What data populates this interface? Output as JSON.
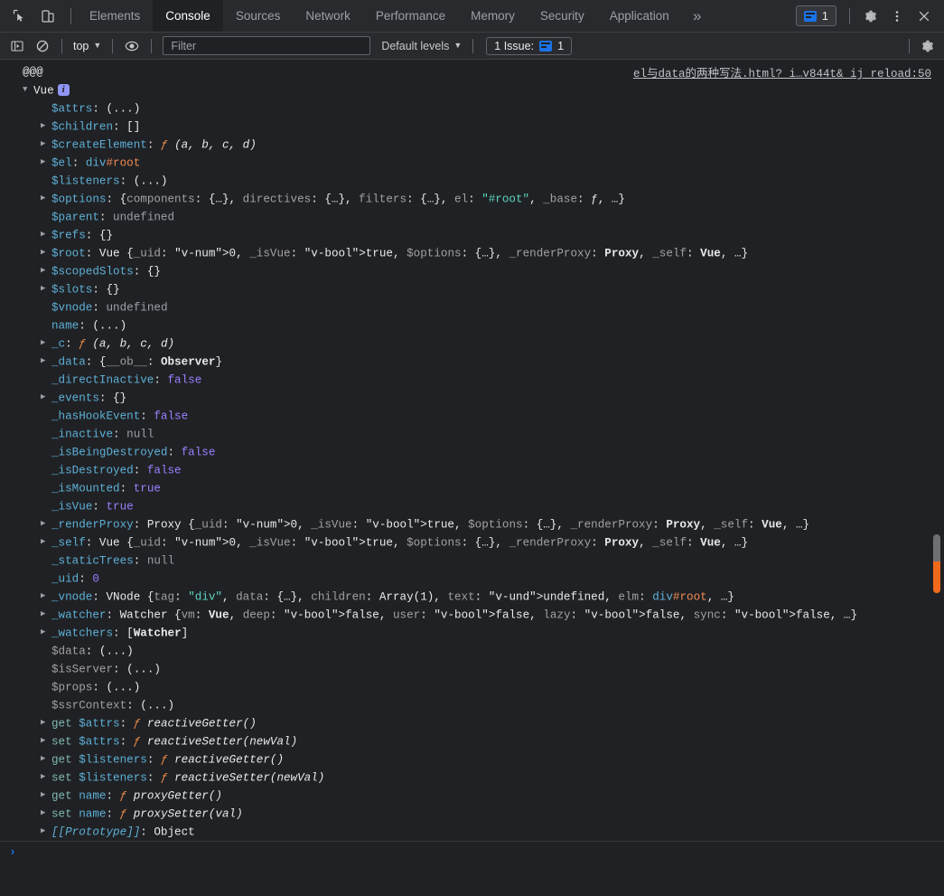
{
  "header": {
    "icons": [
      {
        "name": "inspect-element-icon",
        "title": "Inspect"
      },
      {
        "name": "device-toolbar-icon",
        "title": "Toggle device toolbar"
      }
    ],
    "tabs": [
      {
        "label": "Elements",
        "active": false
      },
      {
        "label": "Console",
        "active": true
      },
      {
        "label": "Sources",
        "active": false
      },
      {
        "label": "Network",
        "active": false
      },
      {
        "label": "Performance",
        "active": false
      },
      {
        "label": "Memory",
        "active": false
      },
      {
        "label": "Security",
        "active": false
      },
      {
        "label": "Application",
        "active": false
      }
    ],
    "more_tabs_label": "»",
    "issues_count": "1",
    "settings_label": "Settings",
    "more_label": "More options",
    "close_label": "Close"
  },
  "toolbar": {
    "sidebar_toggle_name": "console-sidebar-icon",
    "clear_label": "Clear console",
    "context": "top",
    "eye_label": "Create live expression",
    "filter_placeholder": "Filter",
    "filter_value": "",
    "levels": "Default levels",
    "issues_text": "1 Issue:",
    "issues_count": "1",
    "settings_label": "Console settings"
  },
  "console": {
    "source_link": "el与data的两种写法.html?_i…v844t&_ij_reload:50",
    "first_line": "@@@",
    "object_title": "Vue",
    "prompt_symbol": "›",
    "rows": [
      {
        "tri": false,
        "key": "$attrs",
        "keycls": "k-prop",
        "val": "(...)",
        "valcls": "v-obj"
      },
      {
        "tri": true,
        "key": "$children",
        "keycls": "k-prop",
        "val": "[]",
        "valcls": "v-obj"
      },
      {
        "tri": true,
        "key": "$createElement",
        "keycls": "k-prop",
        "val": "ƒ (a, b, c, d)",
        "valcls": "v-fn"
      },
      {
        "tri": true,
        "key": "$el",
        "keycls": "k-prop",
        "val": "div#root",
        "valcls": "v-node-html"
      },
      {
        "tri": false,
        "key": "$listeners",
        "keycls": "k-prop",
        "val": "(...)",
        "valcls": "v-obj"
      },
      {
        "tri": true,
        "key": "$options",
        "keycls": "k-prop",
        "val": "{components: {…}, directives: {…}, filters: {…}, el: \"#root\", _base: ƒ, …}",
        "valcls": "v-preview-options"
      },
      {
        "tri": false,
        "key": "$parent",
        "keycls": "k-prop",
        "val": "undefined",
        "valcls": "v-und"
      },
      {
        "tri": true,
        "key": "$refs",
        "keycls": "k-prop",
        "val": "{}",
        "valcls": "v-obj"
      },
      {
        "tri": true,
        "key": "$root",
        "keycls": "k-prop",
        "val": "Vue {_uid: 0, _isVue: true, $options: {…}, _renderProxy: Proxy, _self: Vue, …}",
        "valcls": "v-preview-vue"
      },
      {
        "tri": true,
        "key": "$scopedSlots",
        "keycls": "k-prop",
        "val": "{}",
        "valcls": "v-obj"
      },
      {
        "tri": true,
        "key": "$slots",
        "keycls": "k-prop",
        "val": "{}",
        "valcls": "v-obj"
      },
      {
        "tri": false,
        "key": "$vnode",
        "keycls": "k-prop",
        "val": "undefined",
        "valcls": "v-und"
      },
      {
        "tri": false,
        "key": "name",
        "keycls": "k-prop",
        "val": "(...)",
        "valcls": "v-obj"
      },
      {
        "tri": true,
        "key": "_c",
        "keycls": "k-prop",
        "val": "ƒ (a, b, c, d)",
        "valcls": "v-fn"
      },
      {
        "tri": true,
        "key": "_data",
        "keycls": "k-prop",
        "val": "{__ob__: Observer}",
        "valcls": "v-preview-data"
      },
      {
        "tri": false,
        "key": "_directInactive",
        "keycls": "k-prop",
        "val": "false",
        "valcls": "v-bool"
      },
      {
        "tri": true,
        "key": "_events",
        "keycls": "k-prop",
        "val": "{}",
        "valcls": "v-obj"
      },
      {
        "tri": false,
        "key": "_hasHookEvent",
        "keycls": "k-prop",
        "val": "false",
        "valcls": "v-bool"
      },
      {
        "tri": false,
        "key": "_inactive",
        "keycls": "k-prop",
        "val": "null",
        "valcls": "v-null"
      },
      {
        "tri": false,
        "key": "_isBeingDestroyed",
        "keycls": "k-prop",
        "val": "false",
        "valcls": "v-bool"
      },
      {
        "tri": false,
        "key": "_isDestroyed",
        "keycls": "k-prop",
        "val": "false",
        "valcls": "v-bool"
      },
      {
        "tri": false,
        "key": "_isMounted",
        "keycls": "k-prop",
        "val": "true",
        "valcls": "v-bool"
      },
      {
        "tri": false,
        "key": "_isVue",
        "keycls": "k-prop",
        "val": "true",
        "valcls": "v-bool"
      },
      {
        "tri": true,
        "key": "_renderProxy",
        "keycls": "k-prop",
        "val": "Proxy {_uid: 0, _isVue: true, $options: {…}, _renderProxy: Proxy, _self: Vue, …}",
        "valcls": "v-preview-proxy"
      },
      {
        "tri": true,
        "key": "_self",
        "keycls": "k-prop",
        "val": "Vue {_uid: 0, _isVue: true, $options: {…}, _renderProxy: Proxy, _self: Vue, …}",
        "valcls": "v-preview-vue"
      },
      {
        "tri": false,
        "key": "_staticTrees",
        "keycls": "k-prop",
        "val": "null",
        "valcls": "v-null"
      },
      {
        "tri": false,
        "key": "_uid",
        "keycls": "k-prop",
        "val": "0",
        "valcls": "v-num"
      },
      {
        "tri": true,
        "key": "_vnode",
        "keycls": "k-prop",
        "val": "VNode {tag: \"div\", data: {…}, children: Array(1), text: undefined, elm: div#root, …}",
        "valcls": "v-preview-vnode"
      },
      {
        "tri": true,
        "key": "_watcher",
        "keycls": "k-prop",
        "val": "Watcher {vm: Vue, deep: false, user: false, lazy: false, sync: false, …}",
        "valcls": "v-preview-watcher"
      },
      {
        "tri": true,
        "key": "_watchers",
        "keycls": "k-prop",
        "val": "[Watcher]",
        "valcls": "v-preview-watchers"
      },
      {
        "tri": false,
        "key": "$data",
        "keycls": "k-proto",
        "val": "(...)",
        "valcls": "v-obj"
      },
      {
        "tri": false,
        "key": "$isServer",
        "keycls": "k-proto",
        "val": "(...)",
        "valcls": "v-obj"
      },
      {
        "tri": false,
        "key": "$props",
        "keycls": "k-proto",
        "val": "(...)",
        "valcls": "v-obj"
      },
      {
        "tri": false,
        "key": "$ssrContext",
        "keycls": "k-proto",
        "val": "(...)",
        "valcls": "v-obj"
      },
      {
        "tri": true,
        "accessor": "get",
        "key": "$attrs",
        "keycls": "k-getter",
        "val": "ƒ reactiveGetter()",
        "valcls": "v-fn"
      },
      {
        "tri": true,
        "accessor": "set",
        "key": "$attrs",
        "keycls": "k-getter",
        "val": "ƒ reactiveSetter(newVal)",
        "valcls": "v-fn"
      },
      {
        "tri": true,
        "accessor": "get",
        "key": "$listeners",
        "keycls": "k-getter",
        "val": "ƒ reactiveGetter()",
        "valcls": "v-fn"
      },
      {
        "tri": true,
        "accessor": "set",
        "key": "$listeners",
        "keycls": "k-getter",
        "val": "ƒ reactiveSetter(newVal)",
        "valcls": "v-fn"
      },
      {
        "tri": true,
        "accessor": "get",
        "key": "name",
        "keycls": "k-getter",
        "val": "ƒ proxyGetter()",
        "valcls": "v-fn"
      },
      {
        "tri": true,
        "accessor": "set",
        "key": "name",
        "keycls": "k-getter",
        "val": "ƒ proxySetter(val)",
        "valcls": "v-fn"
      },
      {
        "tri": true,
        "key": "[[Prototype]]",
        "keycls": "k-prototype",
        "val": "Object",
        "valcls": "v-obj"
      }
    ]
  },
  "colors": {
    "bg": "#202124",
    "chrome": "#292a2d",
    "property": "#5db0d7",
    "string": "#f28b54",
    "boolean": "#9980ff",
    "accent": "#1a73e8",
    "scrollbar_mark": "#f1691b"
  }
}
